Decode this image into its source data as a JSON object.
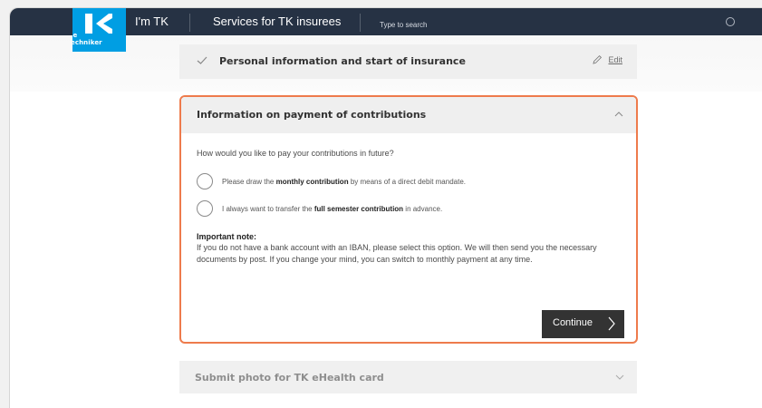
{
  "brand": {
    "logo_text": "ie\nechniker"
  },
  "nav": {
    "link_im_tk": "I'm TK",
    "link_services": "Services for TK insurees",
    "search_placeholder": "Type to search"
  },
  "steps": {
    "personal": {
      "title": "Personal information and start of insurance",
      "edit_label": "Edit"
    },
    "payment": {
      "title": "Information on payment of contributions",
      "question": "How would you like to pay your contributions in future?",
      "option1": {
        "prefix": "Please draw the ",
        "bold": "monthly contribution",
        "suffix": " by means of a direct debit mandate."
      },
      "option2": {
        "prefix": "I always want to transfer the ",
        "bold": "full semester contribution",
        "suffix": " in advance."
      },
      "note_title": "Important note:",
      "note_body": "If you do not have a bank account with an IBAN, please select this option. We will then send you the necessary documents by post. If you change your mind, you can switch to monthly payment at any time.",
      "continue_label": "Continue"
    },
    "photo": {
      "title": "Submit photo for TK eHealth card"
    }
  },
  "colors": {
    "nav_bg": "#263244",
    "logo_bg": "#009ee3",
    "highlight": "#ee7b4c",
    "button_bg": "#333333"
  }
}
